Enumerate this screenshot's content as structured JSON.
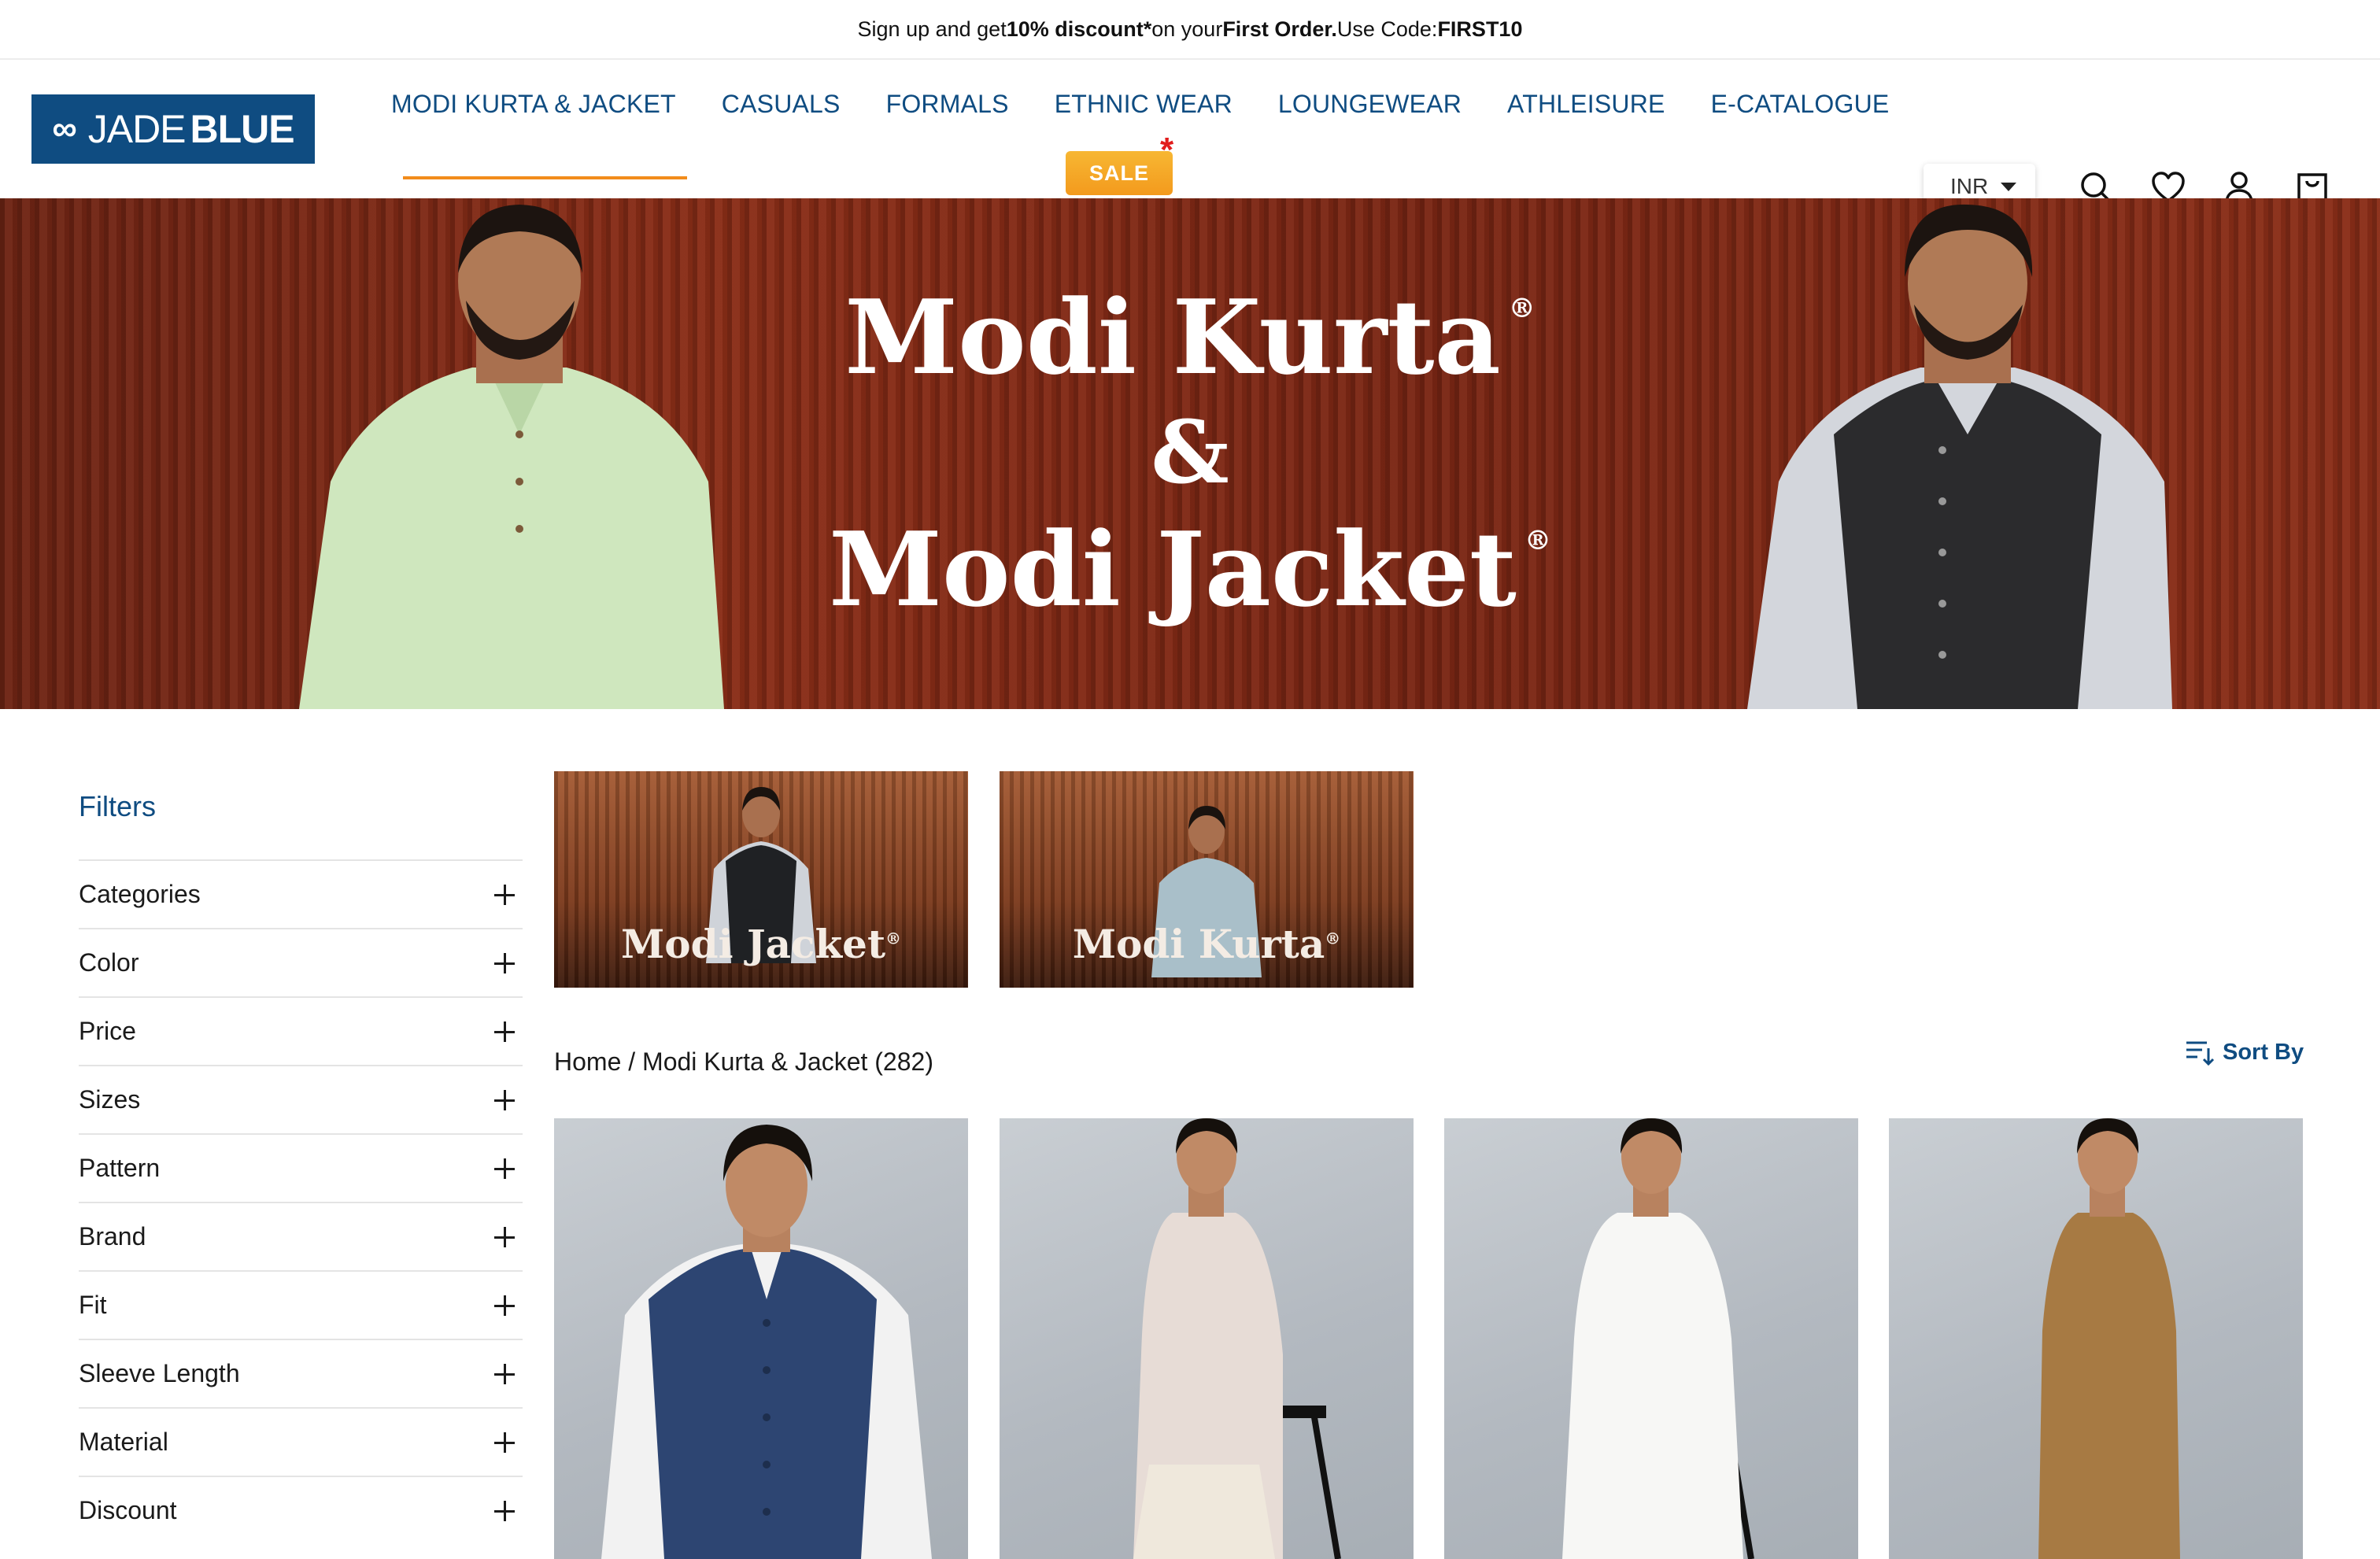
{
  "announcement": {
    "part1": "Sign up and get ",
    "part2": "10% discount*",
    "part3": " on your ",
    "part4": "First Order.",
    "part5": " Use Code: ",
    "part6": "FIRST10"
  },
  "brand": {
    "logo_word1": "JADE",
    "logo_word2": "BLUE",
    "color": "#0f4c81"
  },
  "nav": {
    "items": [
      "MODI KURTA & JACKET",
      "CASUALS",
      "FORMALS",
      "ETHNIC WEAR",
      "LOUNGEWEAR",
      "ATHLEISURE",
      "E-CATALOGUE"
    ],
    "active_index": 0,
    "sale_badge": "SALE",
    "sale_star": "*"
  },
  "header_actions": {
    "currency": "INR",
    "icons": [
      "search-icon",
      "heart-icon",
      "user-icon",
      "bag-icon"
    ]
  },
  "hero": {
    "line1": "Modi Kurta",
    "amp": "&",
    "line2": "Modi Jacket",
    "reg": "®"
  },
  "filters": {
    "title": "Filters",
    "items": [
      "Categories",
      "Color",
      "Price",
      "Sizes",
      "Pattern",
      "Brand",
      "Fit",
      "Sleeve Length",
      "Material",
      "Discount"
    ]
  },
  "category_tiles": [
    {
      "label": "Modi Jacket",
      "reg": "®"
    },
    {
      "label": "Modi Kurta",
      "reg": "®"
    }
  ],
  "breadcrumb": "Home / Modi Kurta & Jacket (282)",
  "sort_label": "Sort By",
  "colors": {
    "accent": "#f28c1b",
    "brand_blue": "#0f4c81",
    "sale_red": "#e11d1d"
  }
}
